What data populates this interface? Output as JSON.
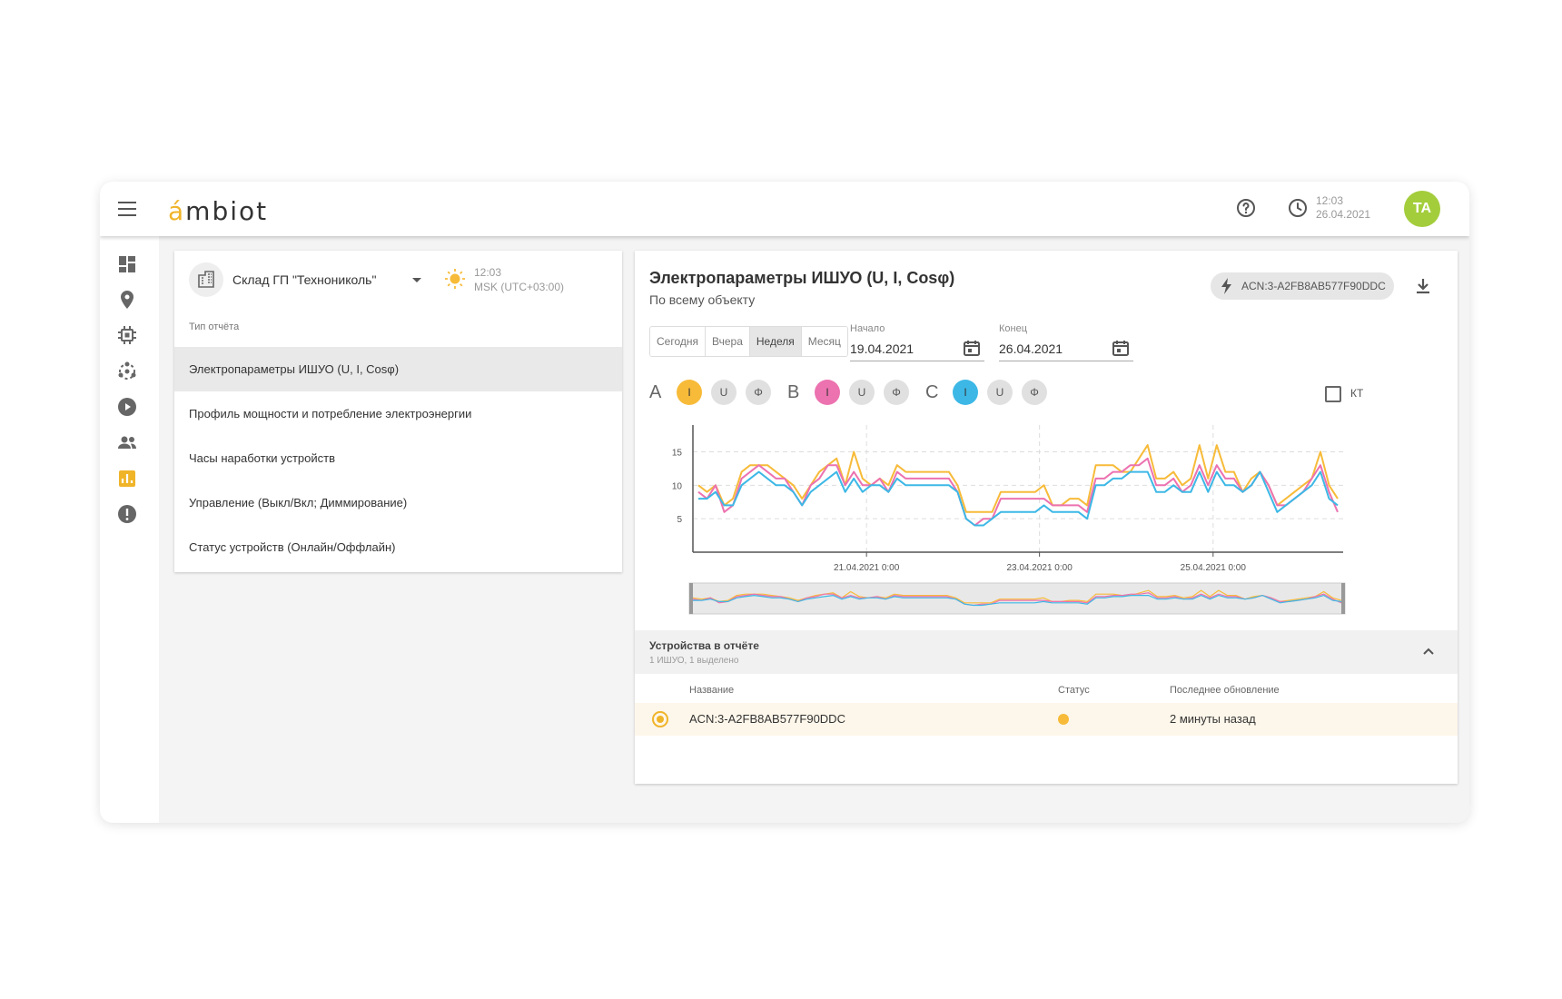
{
  "app": {
    "logo_accent": "á",
    "logo_rest": "mbiot"
  },
  "header": {
    "time": "12:03",
    "date": "26.04.2021",
    "avatar_initials": "TA",
    "avatar_color": "#a3cd3b"
  },
  "sidebar": {
    "icons": [
      "dashboard-icon",
      "location-pin-icon",
      "chip-icon",
      "network-icon",
      "play-icon",
      "users-icon",
      "report-icon",
      "alert-icon"
    ],
    "active_index": 6,
    "active_color": "#f0b429"
  },
  "site": {
    "name": "Склад ГП \"Технониколь\"",
    "time": "12:03",
    "timezone": "MSK (UTC+03:00)"
  },
  "report_types": {
    "label": "Тип отчёта",
    "items": [
      "Электропараметры ИШУО (U, I, Cosφ)",
      "Профиль мощности и потребление электроэнергии",
      "Часы наработки устройств",
      "Управление (Выкл/Вкл; Диммирование)",
      "Статус устройств (Онлайн/Оффлайн)"
    ],
    "active_index": 0
  },
  "report": {
    "title": "Электропараметры ИШУО (U, I, Cosφ)",
    "subtitle": "По всему объекту",
    "device_chip": "ACN:3-A2FB8AB577F90DDC",
    "periods": [
      "Сегодня",
      "Вчера",
      "Неделя",
      "Месяц"
    ],
    "active_period": "Неделя",
    "start_label": "Начало",
    "start_date": "19.04.2021",
    "end_label": "Конец",
    "end_date": "26.04.2021",
    "phases": [
      {
        "letter": "A",
        "chips": [
          "I",
          "U",
          "Φ"
        ],
        "active_chip": "I",
        "color": "#f7bb39"
      },
      {
        "letter": "B",
        "chips": [
          "I",
          "U",
          "Φ"
        ],
        "active_chip": "I",
        "color": "#ec72b0"
      },
      {
        "letter": "C",
        "chips": [
          "I",
          "U",
          "Φ"
        ],
        "active_chip": "I",
        "color": "#3db8e6"
      }
    ],
    "kt_label": "КТ"
  },
  "chart_data": {
    "type": "line",
    "x_tick_labels": [
      "21.04.2021 0:00",
      "23.04.2021 0:00",
      "25.04.2021 0:00"
    ],
    "y_ticks": [
      5,
      10,
      15
    ],
    "ylim": [
      0,
      19
    ],
    "grid": "dashed",
    "series": [
      {
        "color": "#f7bb39",
        "values": [
          10,
          9,
          10,
          7,
          8,
          12,
          13,
          13,
          13,
          12,
          11,
          10,
          8,
          10,
          12,
          13,
          14,
          10,
          15,
          11,
          10,
          11,
          10,
          13,
          12,
          12,
          12,
          12,
          12,
          12,
          10,
          6,
          6,
          6,
          6,
          9,
          9,
          9,
          9,
          9,
          10,
          7,
          7,
          8,
          8,
          7,
          13,
          13,
          13,
          12,
          12,
          14,
          16,
          11,
          11,
          12,
          10,
          11,
          16,
          11,
          16,
          12,
          12,
          9,
          11,
          12,
          10,
          7,
          8,
          9,
          10,
          11,
          15,
          10,
          8
        ]
      },
      {
        "color": "#ec72b0",
        "values": [
          9,
          8,
          10,
          6,
          7,
          11,
          12,
          13,
          12,
          11,
          11,
          9,
          7,
          10,
          11,
          13,
          13,
          10,
          12,
          10,
          10,
          11,
          9,
          12,
          11,
          11,
          11,
          11,
          11,
          11,
          9,
          5,
          4,
          5,
          5,
          8,
          8,
          8,
          8,
          8,
          8,
          7,
          7,
          7,
          7,
          6,
          11,
          11,
          12,
          12,
          13,
          13,
          14,
          10,
          10,
          11,
          9,
          10,
          13,
          10,
          13,
          11,
          11,
          9,
          10,
          12,
          10,
          7,
          7,
          8,
          9,
          11,
          13,
          9,
          6
        ]
      },
      {
        "color": "#3db8e6",
        "values": [
          8,
          8,
          9,
          7,
          7,
          10,
          11,
          12,
          11,
          10,
          10,
          9,
          7,
          9,
          10,
          11,
          12,
          9,
          11,
          9,
          10,
          10,
          9,
          11,
          10,
          10,
          10,
          10,
          10,
          10,
          9,
          5,
          4,
          4,
          5,
          6,
          6,
          6,
          6,
          6,
          7,
          6,
          6,
          6,
          6,
          5,
          10,
          10,
          11,
          11,
          12,
          12,
          12,
          9,
          9,
          10,
          9,
          9,
          12,
          9,
          12,
          10,
          10,
          9,
          10,
          12,
          9,
          6,
          7,
          8,
          9,
          10,
          12,
          8,
          7
        ]
      }
    ]
  },
  "devices": {
    "title": "Устройства в отчёте",
    "subtitle": "1 ИШУО, 1 выделено",
    "columns": {
      "name": "Название",
      "status": "Статус",
      "updated": "Последнее обновление"
    },
    "rows": [
      {
        "name": "ACN:3-A2FB8AB577F90DDC",
        "status_color": "#f7bb39",
        "updated": "2 минуты назад"
      }
    ]
  }
}
